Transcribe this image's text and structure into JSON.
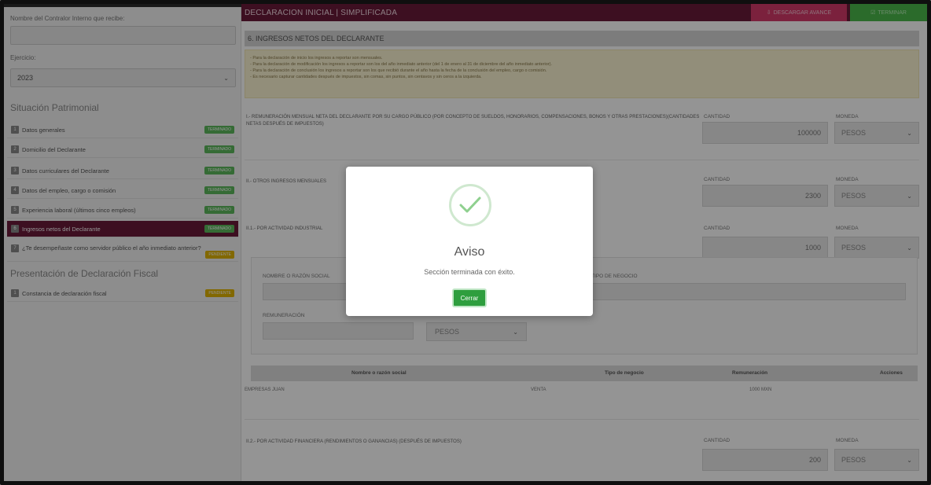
{
  "sidebar": {
    "receiver_label": "Nombre del Contralor Interno que recibe:",
    "receiver_value": "",
    "year_label": "Ejercicio:",
    "year_value": "2023",
    "patrimonial_title": "Situación Patrimonial",
    "items": [
      {
        "num": "1",
        "label": "Datos generales",
        "badge": "TERMINADO"
      },
      {
        "num": "2",
        "label": "Domicilio del Declarante",
        "badge": "TERMINADO"
      },
      {
        "num": "3",
        "label": "Datos curriculares del Declarante",
        "badge": "TERMINADO"
      },
      {
        "num": "4",
        "label": "Datos del empleo, cargo o comisión",
        "badge": "TERMINADO"
      },
      {
        "num": "5",
        "label": "Experiencia laboral (últimos cinco empleos)",
        "badge": "TERMINADO"
      },
      {
        "num": "6",
        "label": "Ingresos netos del Declarante",
        "badge": "TERMINADO"
      },
      {
        "num": "7",
        "label": "¿Te desempeñaste como servidor público el año inmediato anterior?",
        "badge": "PENDIENTE"
      }
    ],
    "fiscal_title": "Presentación de Declaración Fiscal",
    "fiscal_items": [
      {
        "num": "1",
        "label": "Constancia de declaración fiscal",
        "badge": "PENDIENTE"
      }
    ]
  },
  "header": {
    "title": "DECLARACION INICIAL | SIMPLIFICADA",
    "download_label": "DESCARGAR AVANCE",
    "finish_label": "TERMINAR"
  },
  "main": {
    "section_title": "6. INGRESOS NETOS DEL DECLARANTE",
    "notice": [
      "- Para la declaración de inicio los ingresos a reportar son mensuales.",
      "- Para la declaración de modificación los ingresos a reportar son los del año inmediato anterior (del 1 de enero al 31 de diciembre del año inmediato anterior).",
      "- Para la declaración de conclusión los ingresos a reportar son los que recibió durante el año hasta la fecha de la conclusión del empleo, cargo o comisión.",
      "- Es necesario capturar cantidades después de impuestos, sin comas, sin puntos, sin centavos y sin ceros a la izquierda."
    ],
    "q1_label": "I.- REMUNERACIÓN MENSUAL NETA DEL DECLARANTE POR SU CARGO PÚBLICO (POR CONCEPTO DE SUELDOS, HONORARIOS, COMPENSACIONES, BONOS Y OTRAS PRESTACIONES)(CANTIDADES NETAS DESPUÉS DE IMPUESTOS)",
    "q2_label": "II.- OTROS INGRESOS MENSUALES",
    "q3_label": "II.1.- POR ACTIVIDAD INDUSTRIAL",
    "q4_label": "II.2.- POR ACTIVIDAD FINANCIERA (RENDIMIENTOS O GANANCIAS) (DESPUÉS DE IMPUESTOS)",
    "qty_label": "CANTIDAD",
    "cur_label": "MONEDA",
    "q1_qty": "100000",
    "q2_qty": "2300",
    "q3_qty": "1000",
    "q4_qty": "200",
    "currency": "PESOS",
    "sub_name_label": "NOMBRE O RAZÓN SOCIAL",
    "sub_type_label": "TIPO DE NEGOCIO",
    "sub_rem_label": "REMUNERACIÓN",
    "sub_currency": "PESOS",
    "table": {
      "headers": [
        "Nombre o razón social",
        "Tipo de negocio",
        "Remuneración",
        "Acciones"
      ],
      "rows": [
        [
          "EMPRESAS JUAN",
          "VENTA",
          "1000 MXN",
          ""
        ]
      ]
    }
  },
  "modal": {
    "title": "Aviso",
    "message": "Sección terminada con éxito.",
    "button_label": "Cerrar"
  }
}
